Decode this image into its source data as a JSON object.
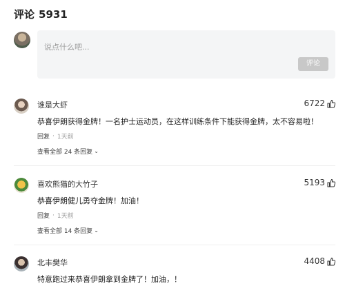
{
  "header": {
    "title": "评论",
    "count": "5931"
  },
  "composer": {
    "placeholder": "说点什么吧...",
    "submit_label": "评论"
  },
  "comments": [
    {
      "name": "谁是大虾",
      "likes": "6722",
      "text": "恭喜伊朗获得金牌！一名护士运动员，在这样训练条件下能获得金牌，太不容易啦！",
      "reply_label": "回复",
      "time": "1天前",
      "view_replies": "查看全部 24 条回复"
    },
    {
      "name": "喜欢熊猫的大竹子",
      "likes": "5193",
      "text": "恭喜伊朗健儿勇夺金牌！加油！",
      "reply_label": "回复",
      "time": "1天前",
      "view_replies": "查看全部 14 条回复"
    },
    {
      "name": "北丰樊华",
      "likes": "4408",
      "text": "特意跑过来恭喜伊朗拿到金牌了！加油，！"
    }
  ],
  "icons": {
    "like": "thumbs-up-icon",
    "expand": "chevron-down-icon"
  }
}
